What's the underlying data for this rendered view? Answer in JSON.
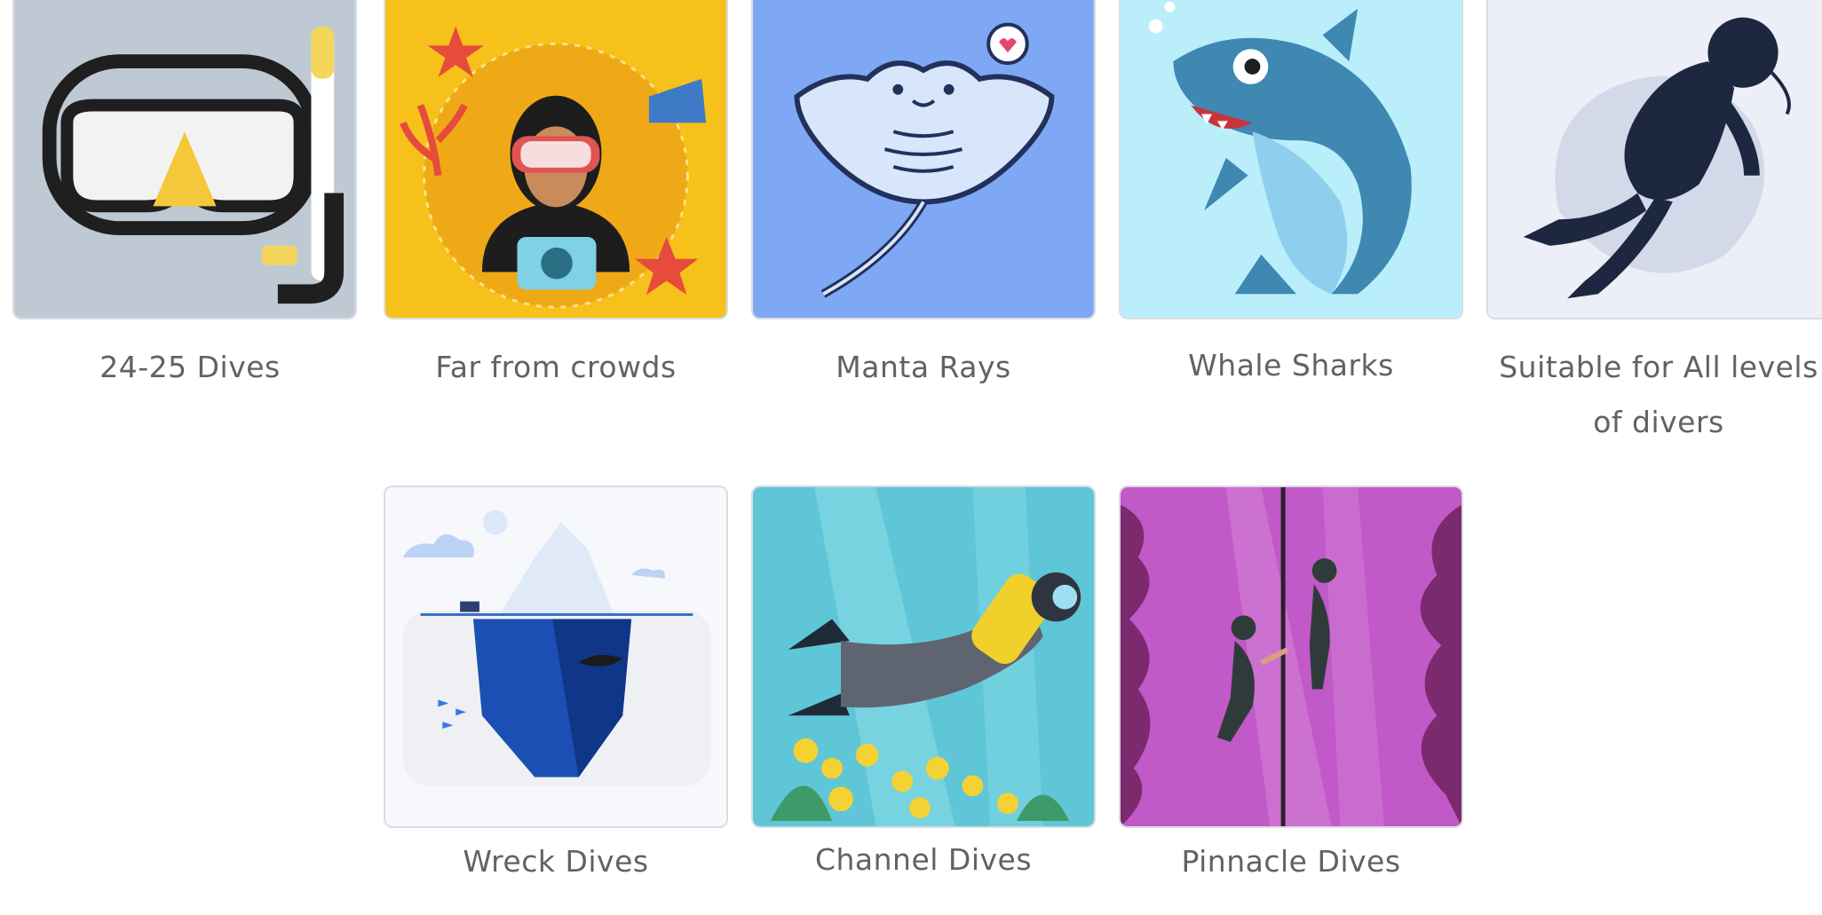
{
  "features": [
    {
      "id": "dives",
      "label": "24-25 Dives",
      "icon": "snorkel-mask-icon",
      "bg": "#bfc9d4"
    },
    {
      "id": "crowds",
      "label": "Far from crowds",
      "icon": "diver-photographer-icon",
      "bg": "#f5c11a"
    },
    {
      "id": "manta",
      "label": "Manta Rays",
      "icon": "manta-ray-icon",
      "bg": "#7fa8f4"
    },
    {
      "id": "whale",
      "label": "Whale Sharks",
      "icon": "whale-shark-icon",
      "bg": "#b9eefa"
    },
    {
      "id": "levels",
      "label": "Suitable for All levels",
      "label_line2": "of divers",
      "icon": "scuba-diver-silhouette-icon",
      "bg": "#eceff8"
    },
    {
      "id": "wreck",
      "label": "Wreck Dives",
      "icon": "iceberg-icon",
      "bg": "#f7f8fb"
    },
    {
      "id": "channel",
      "label": "Channel Dives",
      "icon": "swimming-diver-icon",
      "bg": "#5ec6d6"
    },
    {
      "id": "pinnacle",
      "label": "Pinnacle Dives",
      "icon": "pinnacle-divers-icon",
      "bg": "#c259c8"
    }
  ]
}
